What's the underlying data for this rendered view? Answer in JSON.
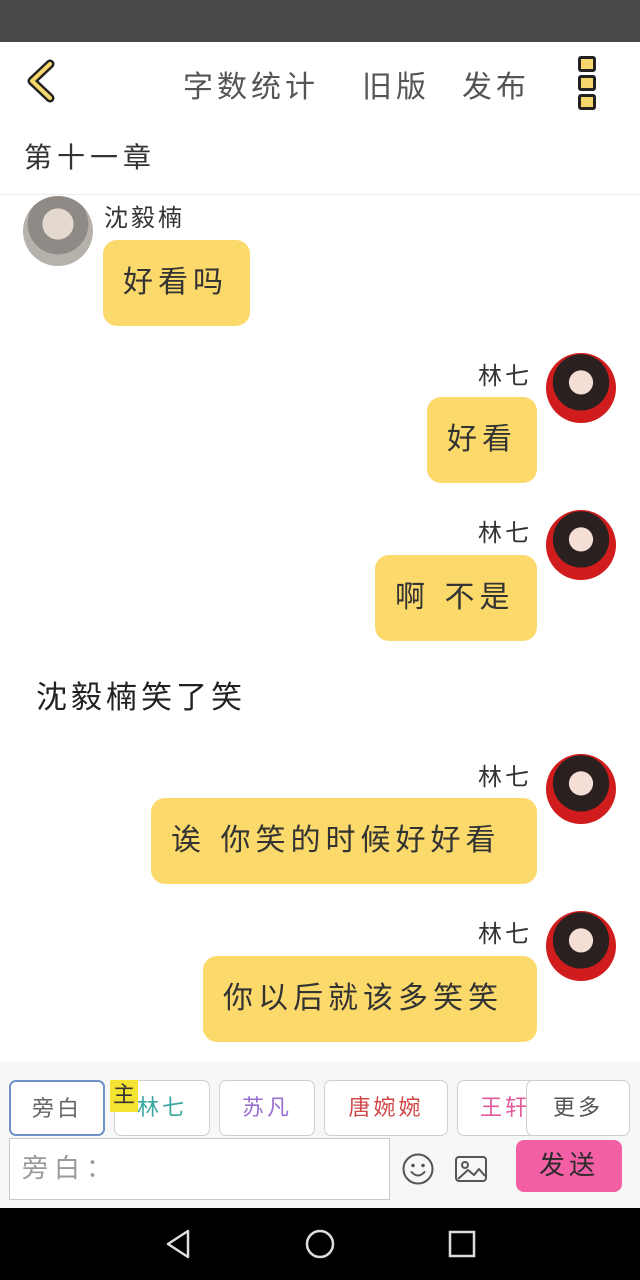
{
  "header": {
    "menu": [
      "字数统计",
      "旧版",
      "发布"
    ],
    "chapter_title": "第十一章"
  },
  "messages": [
    {
      "speaker": "沈毅楠",
      "text": "好看吗",
      "side": "left"
    },
    {
      "speaker": "林七",
      "text": "好看",
      "side": "right"
    },
    {
      "speaker": "林七",
      "text": "啊 不是",
      "side": "right"
    },
    {
      "narration": "沈毅楠笑了笑"
    },
    {
      "speaker": "林七",
      "text": "诶 你笑的时候好好看",
      "side": "right"
    },
    {
      "speaker": "林七",
      "text": "你以后就该多笑笑",
      "side": "right"
    }
  ],
  "roles": [
    {
      "label": "旁白",
      "color": "#666666"
    },
    {
      "label": "林七",
      "color": "#3aa7a0",
      "tag": "主"
    },
    {
      "label": "苏凡",
      "color": "#9b6fd0"
    },
    {
      "label": "唐婉婉",
      "color": "#d04848"
    },
    {
      "label": "王轩",
      "color": "#e05a9c"
    },
    {
      "label": "更多",
      "color": "#555555"
    }
  ],
  "composer": {
    "placeholder": "旁白：",
    "send_label": "发送"
  },
  "colors": {
    "bubble": "#fbd96a",
    "send": "#f25fa5",
    "accent": "#f6d76b"
  }
}
